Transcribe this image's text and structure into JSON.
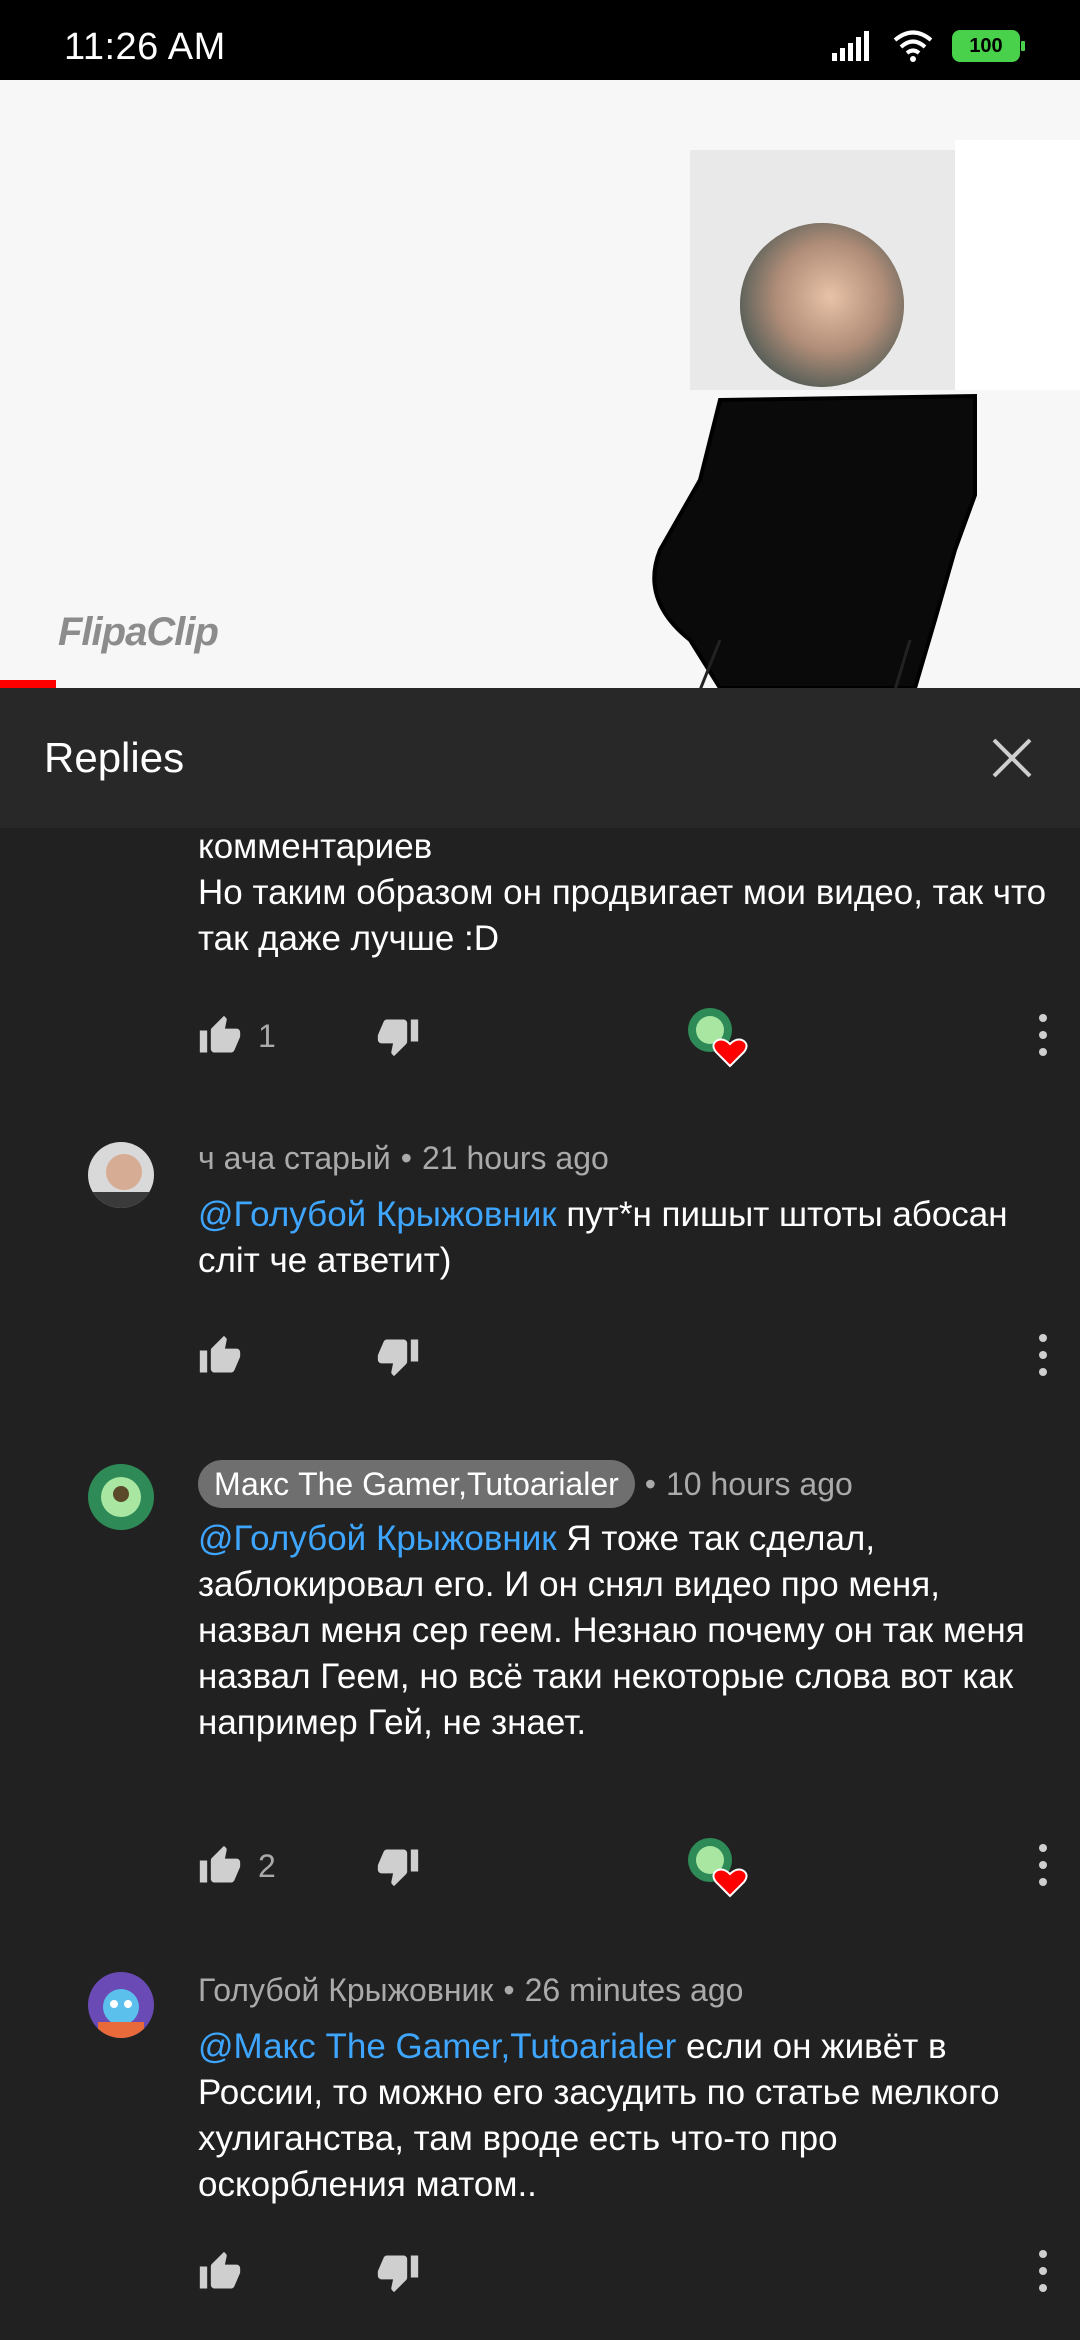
{
  "status_bar": {
    "time": "11:26 AM",
    "battery": "100",
    "icons": [
      "signal-icon",
      "wifi-icon",
      "battery-icon"
    ]
  },
  "video": {
    "watermark": "FlipaClip",
    "progress_percent": 5
  },
  "sheet": {
    "title": "Replies",
    "close_icon": "close-icon"
  },
  "colors": {
    "background": "#212121",
    "header": "#282828",
    "mention": "#3ea6ff",
    "meta": "#aaaaaa",
    "progress": "#ff0000",
    "heart": "#ff0000"
  },
  "replies": [
    {
      "partial": true,
      "text_lines": [
        "комментариев",
        "Но таким образом он продвигает мои видео, так что так даже лучше :D"
      ],
      "likes": "1",
      "hearted": true
    },
    {
      "author": "ч ача старый",
      "time": "21 hours ago",
      "author_highlighted": false,
      "mention": "@Голубой Крыжовник",
      "text": " пут*н пишыт штоты абосан сліт че атветит)",
      "likes": "",
      "hearted": false
    },
    {
      "author": "Макс The Gamer,Tutoarialer",
      "time": "10 hours ago",
      "author_highlighted": true,
      "mention": "@Голубой Крыжовник",
      "text": " Я тоже так сделал, заблокировал его. И он снял видео про меня, назвал меня сер геем. Незнаю почему он так меня назвал Геем, но всё таки некоторые слова вот как например Гей, не знает.",
      "likes": "2",
      "hearted": true
    },
    {
      "author": "Голубой Крыжовник",
      "time": "26 minutes ago",
      "author_highlighted": false,
      "mention": "@Макс The Gamer,Tutoarialer",
      "text": " если он живёт в России, то можно его засудить по статье мелкого хулиганства, там вроде есть что-то про оскорбления матом..",
      "likes": "",
      "hearted": false
    }
  ]
}
